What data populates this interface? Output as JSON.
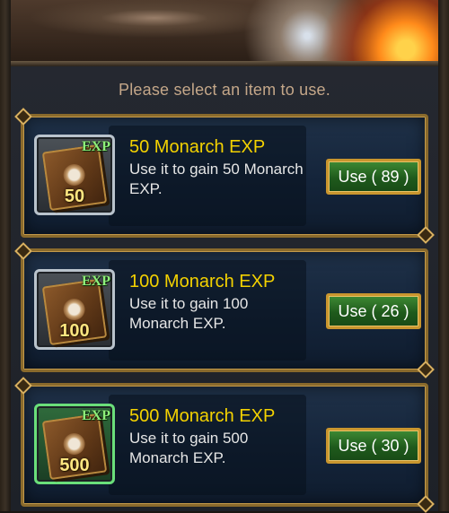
{
  "instruction": "Please select an item to use.",
  "items": [
    {
      "badge_exp": "EXP",
      "badge_amount": "50",
      "title": "50 Monarch EXP",
      "description": "Use it to gain 50 Monarch EXP.",
      "button_label": "Use",
      "count": "( 89 )",
      "frame_color": "silver"
    },
    {
      "badge_exp": "EXP",
      "badge_amount": "100",
      "title": "100 Monarch EXP",
      "description": "Use it to gain 100 Monarch EXP.",
      "button_label": "Use",
      "count": "( 26 )",
      "frame_color": "silver"
    },
    {
      "badge_exp": "EXP",
      "badge_amount": "500",
      "title": "500 Monarch EXP",
      "description": "Use it to gain 500 Monarch EXP.",
      "button_label": "Use",
      "count": "( 30 )",
      "frame_color": "green"
    }
  ],
  "colors": {
    "title": "#f4d200",
    "instruction": "#c4a789",
    "button_green": "#2f7a2a",
    "gold_border": "#8a6a2c"
  }
}
